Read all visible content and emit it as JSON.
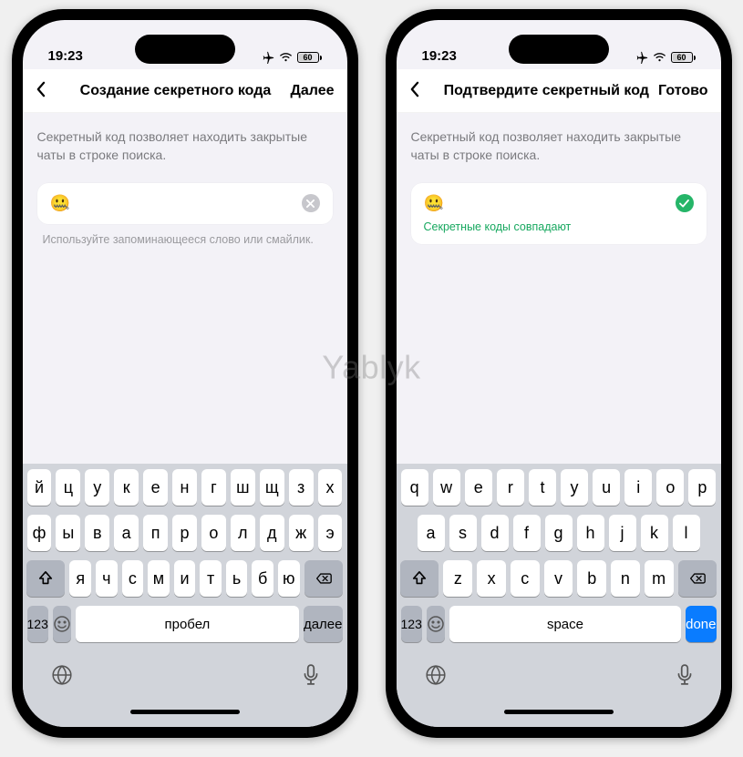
{
  "watermark": "Yablyk",
  "status": {
    "time": "19:23",
    "battery": "60"
  },
  "left": {
    "header": {
      "title": "Создание секретного кода",
      "action": "Далее"
    },
    "desc": "Секретный код позволяет находить закрытые чаты в строке поиска.",
    "input": {
      "value": "🤐"
    },
    "hint": "Используйте запоминающееся слово или смайлик.",
    "keyboard": {
      "row1": [
        "й",
        "ц",
        "у",
        "к",
        "е",
        "н",
        "г",
        "ш",
        "щ",
        "з",
        "х"
      ],
      "row2": [
        "ф",
        "ы",
        "в",
        "а",
        "п",
        "р",
        "о",
        "л",
        "д",
        "ж",
        "э"
      ],
      "row3": [
        "я",
        "ч",
        "с",
        "м",
        "и",
        "т",
        "ь",
        "б",
        "ю"
      ],
      "numbers": "123",
      "space": "Пробел",
      "next": "Далее"
    }
  },
  "right": {
    "header": {
      "title": "Подтвердите секретный код",
      "action": "Готово"
    },
    "desc": "Секретный код позволяет находить закрытые чаты в строке поиска.",
    "input": {
      "value": "🤐",
      "sub": "Секретные коды совпадают"
    },
    "keyboard": {
      "row1": [
        "q",
        "w",
        "e",
        "r",
        "t",
        "y",
        "u",
        "i",
        "o",
        "p"
      ],
      "row2": [
        "a",
        "s",
        "d",
        "f",
        "g",
        "h",
        "j",
        "k",
        "l"
      ],
      "row3": [
        "z",
        "x",
        "c",
        "v",
        "b",
        "n",
        "m"
      ],
      "numbers": "123",
      "space": "space",
      "done": "done"
    }
  }
}
